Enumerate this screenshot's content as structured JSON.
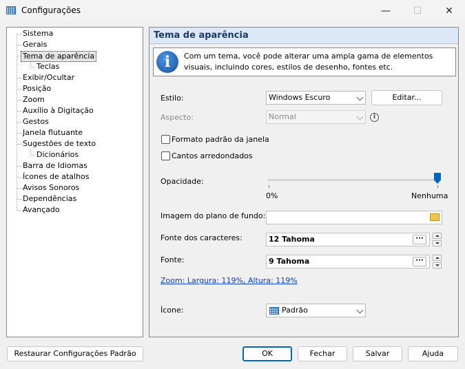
{
  "window": {
    "title": "Configurações",
    "minimize": "—",
    "maximize": "☐",
    "close": "✕"
  },
  "tree": {
    "items": [
      {
        "label": "Sistema",
        "level": 0
      },
      {
        "label": "Gerais",
        "level": 0
      },
      {
        "label": "Tema de aparência",
        "level": 0,
        "selected": true
      },
      {
        "label": "Teclas",
        "level": 1
      },
      {
        "label": "Exibir/Ocultar",
        "level": 0
      },
      {
        "label": "Posição",
        "level": 0
      },
      {
        "label": "Zoom",
        "level": 0
      },
      {
        "label": "Auxílio à Digitação",
        "level": 0
      },
      {
        "label": "Gestos",
        "level": 0
      },
      {
        "label": "Janela flutuante",
        "level": 0
      },
      {
        "label": "Sugestões de texto",
        "level": 0
      },
      {
        "label": "Dicionários",
        "level": 1
      },
      {
        "label": "Barra de Idiomas",
        "level": 0
      },
      {
        "label": "Ícones de atalhos",
        "level": 0
      },
      {
        "label": "Avisos Sonoros",
        "level": 0
      },
      {
        "label": "Dependências",
        "level": 0
      },
      {
        "label": "Avançado",
        "level": 0
      }
    ]
  },
  "panel": {
    "title": "Tema de aparência",
    "info_text": "Com um tema, você pode alterar uma ampla gama de elementos visuais, incluindo cores, estilos de desenho, fontes etc.",
    "info_glyph": "i",
    "style_label": "Estilo:",
    "style_value": "Windows Escuro",
    "edit_button": "Editar...",
    "aspect_label": "Aspecto:",
    "aspect_value": "Normal",
    "help_glyph": "i",
    "checkbox_window_format": "Formato padrão da janela",
    "checkbox_rounded": "Cantos arredondados",
    "opacity_label": "Opacidade:",
    "opacity_fraction": 1.0,
    "opacity_min_label": "0%",
    "opacity_max_label": "Nenhuma",
    "background_label": "Imagem do plano de fundo:",
    "background_value": "",
    "char_font_label": "Fonte dos caracteres:",
    "char_font_value": "12 Tahoma",
    "font_label": "Fonte:",
    "font_value": "9 Tahoma",
    "dots": "···",
    "zoom_link": "Zoom: Largura: 119%, Altura: 119%",
    "icon_label": "Ícone:",
    "icon_value": "Padrão"
  },
  "footer": {
    "restore_button": "Restaurar Configurações Padrão",
    "ok_button": "OK",
    "close_button": "Fechar",
    "save_button": "Salvar",
    "help_button": "Ajuda"
  }
}
